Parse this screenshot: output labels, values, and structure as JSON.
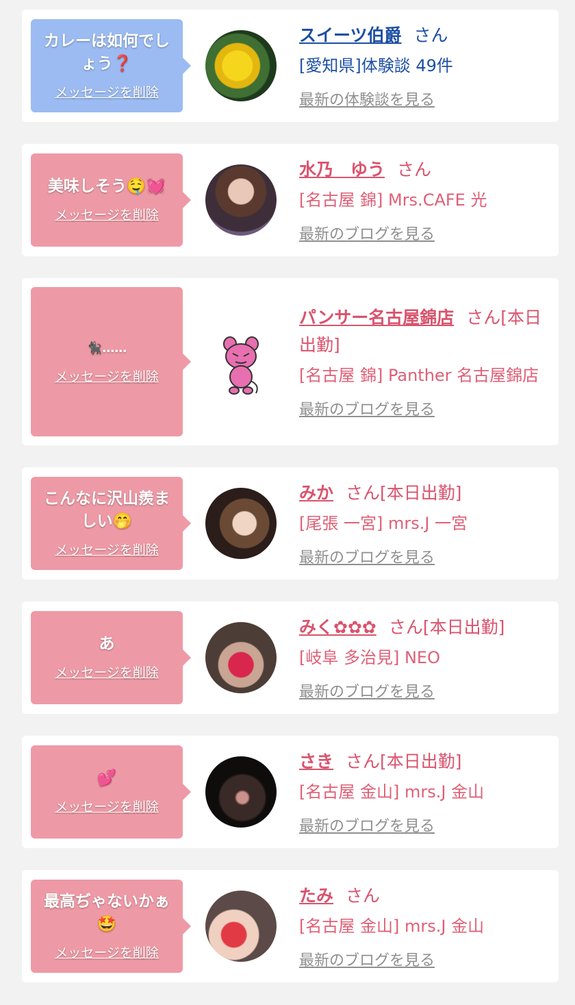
{
  "delete_label": "メッセージを削除",
  "san_suffix": "さん",
  "colors": {
    "blue_bubble": "#9bbbf2",
    "pink_bubble": "#ee9aa6",
    "blue_text": "#1d4fa3",
    "pink_text": "#d9536d"
  },
  "cards": [
    {
      "message": "カレーは如何でしょう❓",
      "name": "スイーツ伯爵",
      "suffix": "さん",
      "shop": "[愛知県]体験談 49件",
      "latest": "最新の体験談を見る",
      "avatar": "yellow-flower"
    },
    {
      "message": "美味しそう🤤💓",
      "name": "水乃　ゆう",
      "suffix": "さん",
      "shop": "[名古屋 錦] Mrs.CAFE 光",
      "latest": "最新のブログを見る",
      "avatar": "woman-photo"
    },
    {
      "message": "🐈‍⬛……",
      "name": "パンサー名古屋錦店",
      "suffix": "さん[本日出勤]",
      "shop": "[名古屋 錦] Panther 名古屋錦店",
      "latest": "最新のブログを見る",
      "avatar": "pink-panther-character"
    },
    {
      "message": "こんなに沢山羨ましい🤭",
      "name": "みか",
      "suffix": "さん[本日出勤]",
      "shop": "[尾張 一宮] mrs.J 一宮",
      "latest": "最新のブログを見る",
      "avatar": "woman-with-cat-stickers"
    },
    {
      "message": "あ",
      "name": "みく✿✿✿",
      "suffix": "さん[本日出勤]",
      "shop": "[岐阜 多治見] NEO",
      "latest": "最新のブログを見る",
      "avatar": "woman-heart-mask"
    },
    {
      "message": "💕",
      "name": "さき",
      "suffix": "さん[本日出勤]",
      "shop": "[名古屋 金山] mrs.J 金山",
      "latest": "最新のブログを見る",
      "avatar": "ear-closeup"
    },
    {
      "message": "最高ぢゃないかぁ🤩",
      "name": "たみ",
      "suffix": "さん",
      "shop": "[名古屋 金山] mrs.J 金山",
      "latest": "最新のブログを見る",
      "avatar": "woman-strawberry"
    }
  ]
}
